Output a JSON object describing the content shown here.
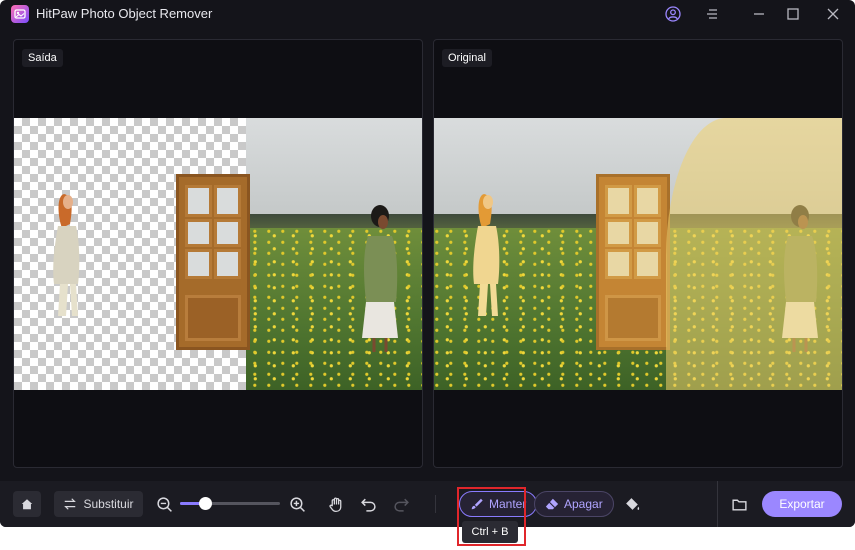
{
  "window": {
    "title": "HitPaw Photo Object Remover"
  },
  "panels": {
    "output_label": "Saída",
    "original_label": "Original"
  },
  "toolbar": {
    "replace_label": "Substituir",
    "zoom_level": 0.25,
    "keep_label": "Manter",
    "erase_label": "Apagar",
    "export_label": "Exportar",
    "keep_shortcut": "Ctrl + B"
  },
  "colors": {
    "accent": "#9b87ff",
    "keep_accent": "#8a7bff",
    "highlight_box": "#e0262b",
    "background": "#14141a"
  },
  "icons": [
    "app-logo-icon",
    "account-icon",
    "menu-icon",
    "minimize-icon",
    "maximize-icon",
    "close-icon",
    "home-icon",
    "swap-icon",
    "zoom-out-icon",
    "zoom-in-icon",
    "hand-icon",
    "undo-icon",
    "redo-icon",
    "brush-icon",
    "eraser-icon",
    "fill-bucket-icon",
    "folder-icon"
  ]
}
